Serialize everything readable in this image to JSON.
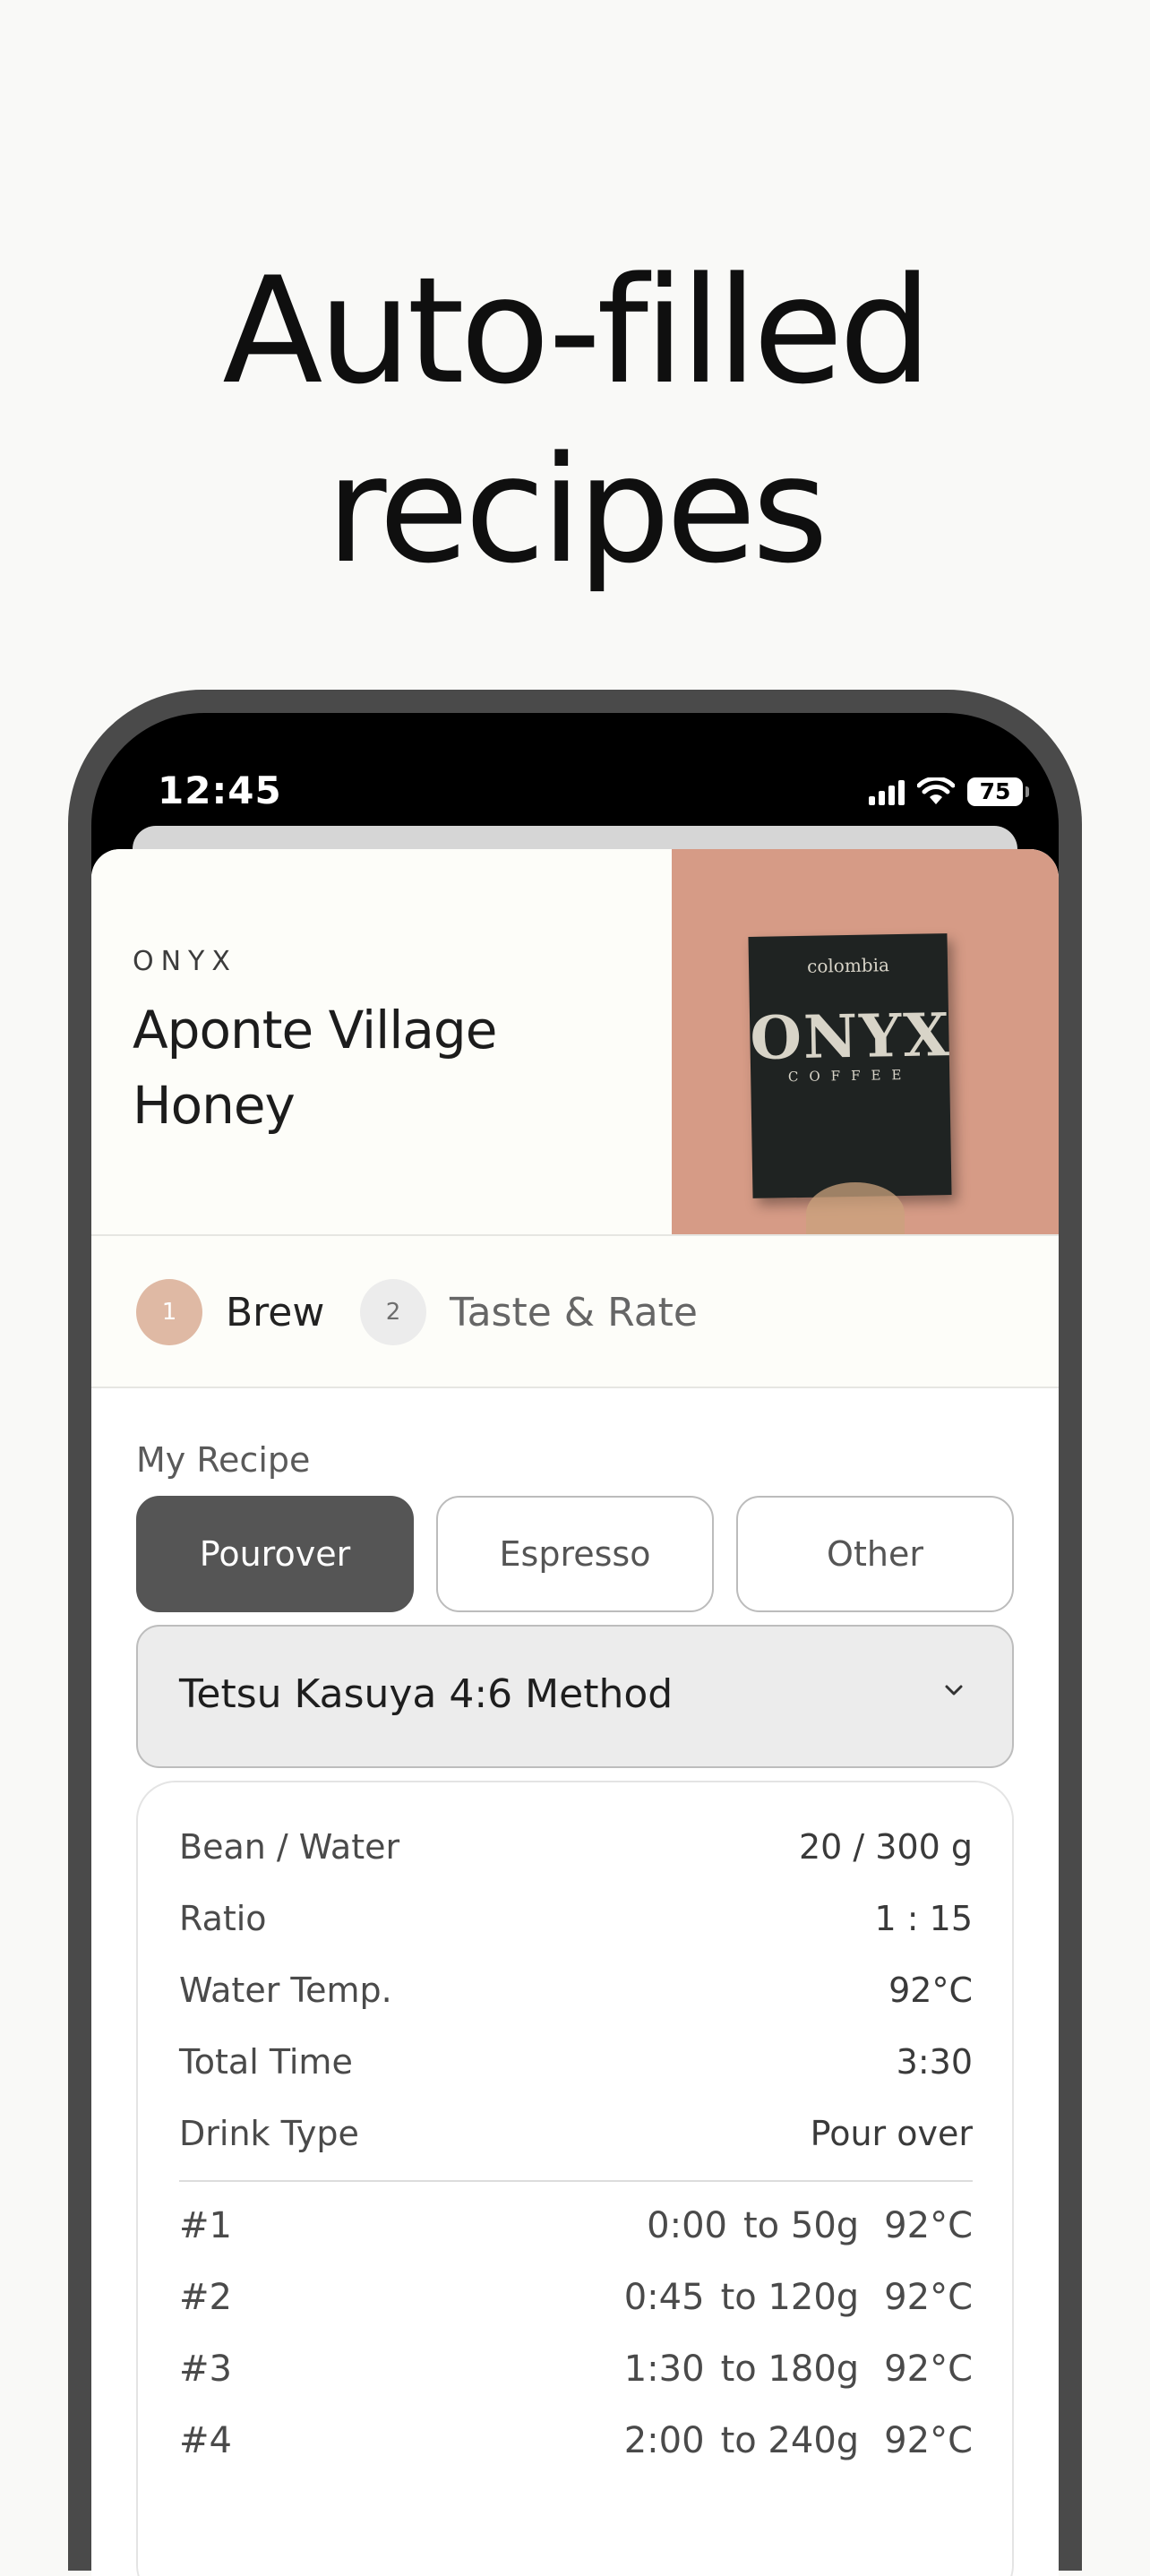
{
  "headline": {
    "line1": "Auto-filled",
    "line2": "recipes"
  },
  "status_bar": {
    "time": "12:45",
    "battery": "75",
    "icons": [
      "cellular-signal-icon",
      "wifi-icon",
      "battery-icon"
    ]
  },
  "coffee": {
    "roaster": "ONYX",
    "name": "Aponte Village Honey",
    "photo": {
      "bag_origin": "colombia",
      "bag_brand": "ONYX",
      "bag_sub": "COFFEE"
    }
  },
  "steps": [
    {
      "number": "1",
      "label": "Brew"
    },
    {
      "number": "2",
      "label": "Taste & Rate"
    }
  ],
  "recipe": {
    "section_label": "My Recipe",
    "brew_methods": [
      "Pourover",
      "Espresso",
      "Other"
    ],
    "selected_brew_method": "Pourover",
    "recipe_template": "Tetsu Kasuya 4:6 Method",
    "details": [
      {
        "label": "Bean / Water",
        "value": "20 / 300 g"
      },
      {
        "label": "Ratio",
        "value": "1 : 15"
      },
      {
        "label": "Water Temp.",
        "value": "92°C"
      },
      {
        "label": "Total Time",
        "value": "3:30"
      },
      {
        "label": "Drink Type",
        "value": "Pour over"
      }
    ],
    "pours": [
      {
        "num": "#1",
        "time": "0:00",
        "target": "to 50g",
        "temp": "92°C"
      },
      {
        "num": "#2",
        "time": "0:45",
        "target": "to 120g",
        "temp": "92°C"
      },
      {
        "num": "#3",
        "time": "1:30",
        "target": "to 180g",
        "temp": "92°C"
      },
      {
        "num": "#4",
        "time": "2:00",
        "target": "to 240g",
        "temp": "92°C"
      }
    ]
  },
  "colors": {
    "accent_step": "#dfb9a4",
    "selected_segment": "#555555",
    "photo_bg": "#d69b86"
  }
}
